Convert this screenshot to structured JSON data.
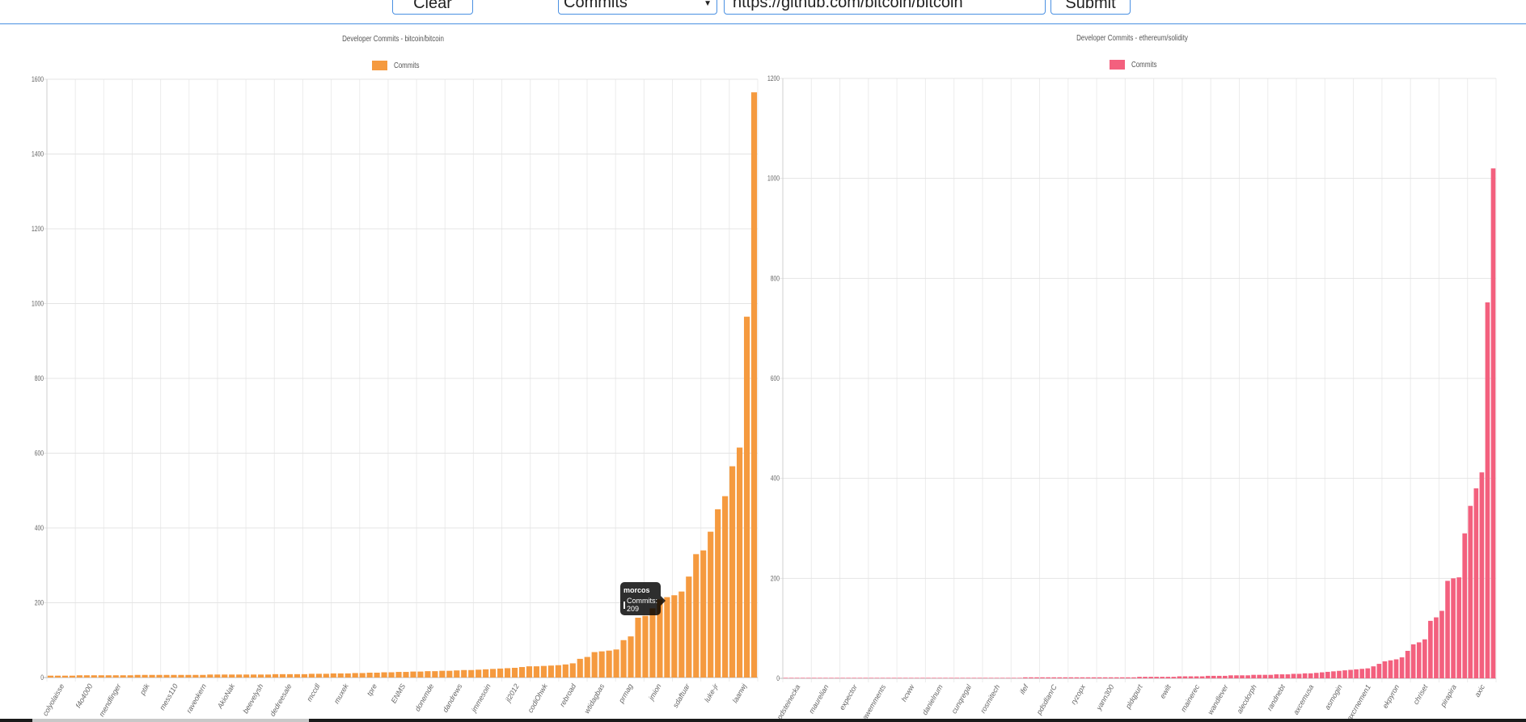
{
  "toolbar": {
    "clear_label": "Clear",
    "metric_selected": "Commits",
    "repo_url": "https://github.com/bitcoin/bitcoin",
    "submit_label": "Submit"
  },
  "colors": {
    "bitcoin": "#f59a3f",
    "solidity": "#f3607e",
    "accent": "#4a90e2"
  },
  "tooltip": {
    "title": "morcos",
    "label": "Commits: 209"
  },
  "chart_data": [
    {
      "type": "bar",
      "title": "Developer Commits - bitcoin/bitcoin",
      "legend": "Commits",
      "ylim": [
        0,
        1600
      ],
      "yticks": [
        "0",
        "200",
        "400",
        "600",
        "800",
        "1000",
        "1200",
        "1400",
        "1600"
      ],
      "tick_labels": [
        "colyolaisse",
        "f4o4000",
        "mendfinger",
        "ptik",
        "mess110",
        "raveokern",
        "AkioNak",
        "beevelysh",
        "dedreesale",
        "mccdl",
        "muxek",
        "tpre",
        "ENMS",
        "donemde",
        "dandrews",
        "jmmesoin",
        "jl2012",
        "codiOhwk",
        "rebroad",
        "wtidagbas",
        "prmag",
        "jmion",
        "sdaftuar",
        "luke-jr",
        "laanwj"
      ],
      "values": [
        5,
        5,
        5,
        5,
        6,
        6,
        6,
        6,
        6,
        6,
        6,
        6,
        7,
        7,
        7,
        7,
        7,
        7,
        7,
        7,
        7,
        7,
        8,
        8,
        8,
        8,
        8,
        8,
        8,
        8,
        8,
        9,
        9,
        9,
        9,
        9,
        10,
        10,
        10,
        11,
        11,
        11,
        12,
        12,
        13,
        13,
        14,
        14,
        15,
        15,
        16,
        16,
        17,
        17,
        18,
        18,
        19,
        20,
        20,
        21,
        22,
        23,
        24,
        25,
        26,
        28,
        30,
        30,
        31,
        32,
        33,
        35,
        38,
        50,
        55,
        68,
        70,
        72,
        75,
        100,
        110,
        160,
        165,
        185,
        209,
        215,
        220,
        230,
        270,
        330,
        340,
        390,
        450,
        485,
        565,
        615,
        965,
        1565
      ]
    },
    {
      "type": "bar",
      "title": "Developer Commits - ethereum/solidity",
      "legend": "Commits",
      "ylim": [
        0,
        1200
      ],
      "yticks": [
        "0",
        "200",
        "400",
        "600",
        "800",
        "1000",
        "1200"
      ],
      "tick_labels": [
        "pdsteinecka",
        "maurelian",
        "expector",
        "gawemments",
        "hcww",
        "danielnum",
        "cunqregal",
        "rosmitech",
        "ifef",
        "pdsdlanrC",
        "ryzopx",
        "yann300",
        "pldqpurt",
        "ewilt",
        "mainerec",
        "wandlever",
        "alecdorph",
        "randnebt",
        "axcemusa",
        "asmogin",
        "axcrnemen1",
        "ekpyron",
        "chriset",
        "pirapira",
        "axic"
      ],
      "values": [
        1,
        1,
        1,
        1,
        1,
        1,
        1,
        1,
        1,
        1,
        1,
        1,
        1,
        1,
        1,
        1,
        1,
        1,
        1,
        1,
        1,
        1,
        1,
        1,
        1,
        1,
        1,
        1,
        1,
        1,
        1,
        1,
        1,
        1,
        1,
        1,
        1,
        1,
        1,
        1,
        1,
        1,
        2,
        2,
        2,
        2,
        2,
        2,
        2,
        2,
        2,
        2,
        2,
        2,
        2,
        2,
        2,
        2,
        2,
        2,
        2,
        2,
        3,
        3,
        3,
        3,
        3,
        3,
        3,
        4,
        4,
        4,
        4,
        4,
        5,
        5,
        5,
        5,
        6,
        6,
        6,
        6,
        7,
        7,
        7,
        7,
        8,
        8,
        8,
        9,
        9,
        10,
        10,
        11,
        12,
        13,
        14,
        15,
        16,
        17,
        18,
        19,
        20,
        24,
        29,
        34,
        36,
        38,
        42,
        55,
        68,
        72,
        78,
        115,
        122,
        135,
        195,
        200,
        202,
        290,
        345,
        380,
        412,
        752,
        1020
      ]
    }
  ]
}
